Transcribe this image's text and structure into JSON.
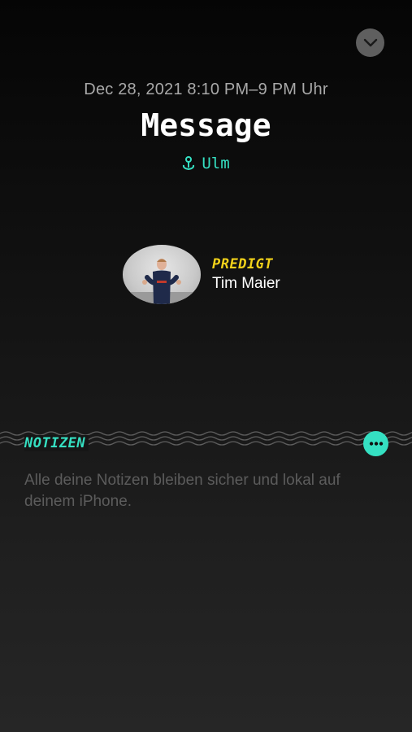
{
  "header": {
    "date": "Dec 28, 2021 8:10 PM–9 PM Uhr",
    "title": "Message",
    "location": "Ulm",
    "collapse_icon": "chevron-down-icon",
    "location_icon": "map-pin-icon"
  },
  "speaker": {
    "role": "PREDIGT",
    "name": "Tim Maier"
  },
  "notes": {
    "label": "NOTIZEN",
    "placeholder": "Alle deine Notizen bleiben sicher und lokal auf deinem iPhone.",
    "more_icon": "ellipsis-icon"
  },
  "colors": {
    "accent": "#35e0c2",
    "role": "#f2d21a",
    "muted_text": "#a9a9a9",
    "placeholder_text": "#5c5c5c"
  }
}
